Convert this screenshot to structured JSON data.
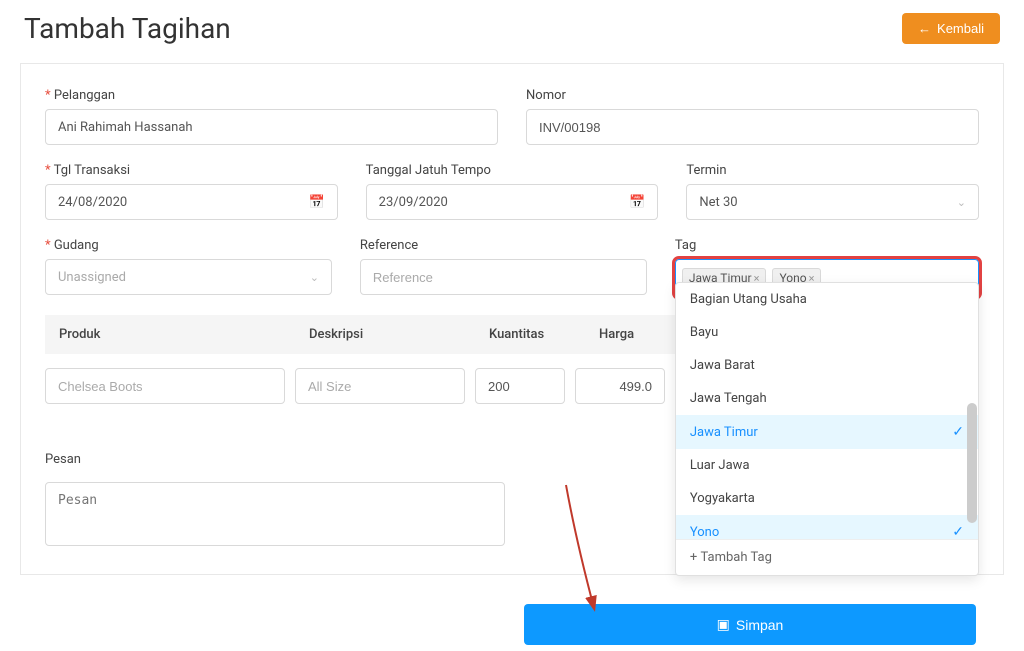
{
  "header": {
    "title": "Tambah Tagihan",
    "back_label": "Kembali"
  },
  "form": {
    "pelanggan": {
      "label": "Pelanggan",
      "value": "Ani Rahimah Hassanah"
    },
    "nomor": {
      "label": "Nomor",
      "value": "INV/00198"
    },
    "tgl_transaksi": {
      "label": "Tgl Transaksi",
      "value": "24/08/2020"
    },
    "tgl_jatuh": {
      "label": "Tanggal Jatuh Tempo",
      "value": "23/09/2020"
    },
    "termin": {
      "label": "Termin",
      "value": "Net 30"
    },
    "gudang": {
      "label": "Gudang",
      "value": "Unassigned"
    },
    "reference": {
      "label": "Reference",
      "placeholder": "Reference"
    },
    "tag": {
      "label": "Tag",
      "selected": [
        "Jawa Timur",
        "Yono"
      ],
      "options": [
        {
          "label": "Bagian Utang Usaha",
          "selected": false
        },
        {
          "label": "Bayu",
          "selected": false
        },
        {
          "label": "Jawa Barat",
          "selected": false
        },
        {
          "label": "Jawa Tengah",
          "selected": false
        },
        {
          "label": "Jawa Timur",
          "selected": true
        },
        {
          "label": "Luar Jawa",
          "selected": false
        },
        {
          "label": "Yogyakarta",
          "selected": false
        },
        {
          "label": "Yono",
          "selected": true
        }
      ],
      "add_label": "Tambah Tag"
    }
  },
  "table": {
    "headers": {
      "produk": "Produk",
      "deskripsi": "Deskripsi",
      "kuantitas": "Kuantitas",
      "harga": "Harga"
    },
    "row": {
      "produk": "Chelsea Boots",
      "deskripsi": "All Size",
      "kuantitas": "200",
      "harga": "499.0"
    }
  },
  "pesan": {
    "label": "Pesan",
    "placeholder": "Pesan"
  },
  "save_label": "Simpan"
}
